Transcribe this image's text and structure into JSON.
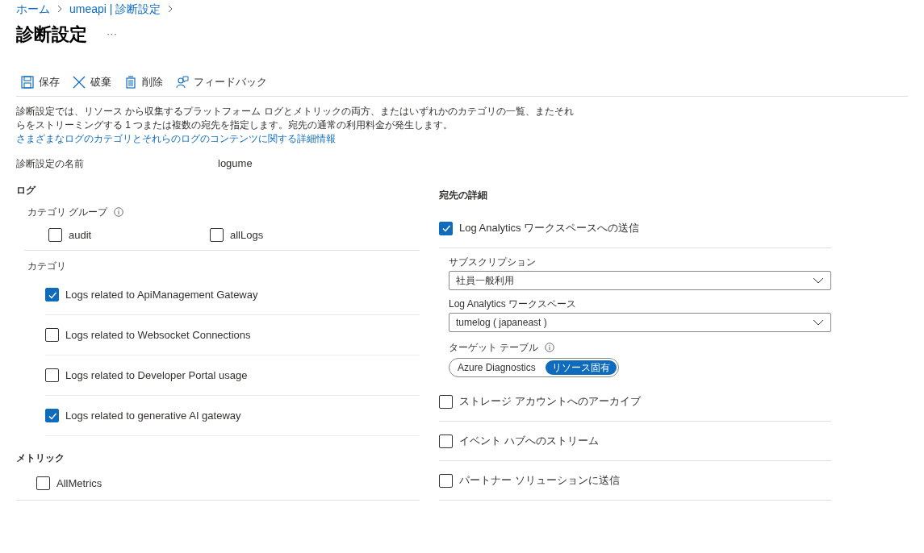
{
  "breadcrumb": [
    {
      "label": "ホーム"
    },
    {
      "label": "umeapi | 診断設定"
    }
  ],
  "title": "診断設定",
  "more": "···",
  "toolbar": [
    {
      "kind": "save",
      "label": "保存"
    },
    {
      "kind": "discard",
      "label": "破棄"
    },
    {
      "kind": "delete",
      "label": "削除"
    },
    {
      "kind": "feedback",
      "label": "フィードバック"
    }
  ],
  "description": {
    "text": "診断設定では、リソース から収集するプラットフォーム ログとメトリックの両方、またはいずれかのカテゴリの一覧、またそれらをストリーミングする 1 つまたは複数の宛先を指定します。宛先の通常の利用料金が発生します。",
    "link": "さまざまなログのカテゴリとそれらのログのコンテンツに関する詳細情報"
  },
  "name_field": {
    "label": "診断設定の名前",
    "value": "logume"
  },
  "logs": {
    "heading": "ログ",
    "category_group": {
      "label": "カテゴリ グループ",
      "items": [
        {
          "label": "audit",
          "checked": false
        },
        {
          "label": "allLogs",
          "checked": false
        }
      ]
    },
    "category": {
      "label": "カテゴリ",
      "items": [
        {
          "label": "Logs related to ApiManagement Gateway",
          "checked": true
        },
        {
          "label": "Logs related to Websocket Connections",
          "checked": false
        },
        {
          "label": "Logs related to Developer Portal usage",
          "checked": false
        },
        {
          "label": "Logs related to generative AI gateway",
          "checked": true
        }
      ]
    }
  },
  "metrics": {
    "heading": "メトリック",
    "items": [
      {
        "label": "AllMetrics",
        "checked": false
      }
    ]
  },
  "destinations": {
    "heading": "宛先の詳細",
    "items": [
      {
        "kind": "log_analytics",
        "label": "Log Analytics ワークスペースへの送信",
        "checked": true,
        "subscription": {
          "label": "サブスクリプション",
          "value": "社員一般利用"
        },
        "workspace": {
          "label": "Log Analytics ワークスペース",
          "value": "tumelog ( japaneast )"
        },
        "target_table": {
          "label": "ターゲット テーブル",
          "options": [
            {
              "label": "Azure Diagnostics",
              "selected": false
            },
            {
              "label": "リソース固有",
              "selected": true
            }
          ]
        }
      },
      {
        "kind": "plain",
        "label": "ストレージ アカウントへのアーカイブ",
        "checked": false
      },
      {
        "kind": "plain",
        "label": "イベント ハブへのストリーム",
        "checked": false
      },
      {
        "kind": "plain",
        "label": "パートナー ソリューションに送信",
        "checked": false
      }
    ]
  }
}
